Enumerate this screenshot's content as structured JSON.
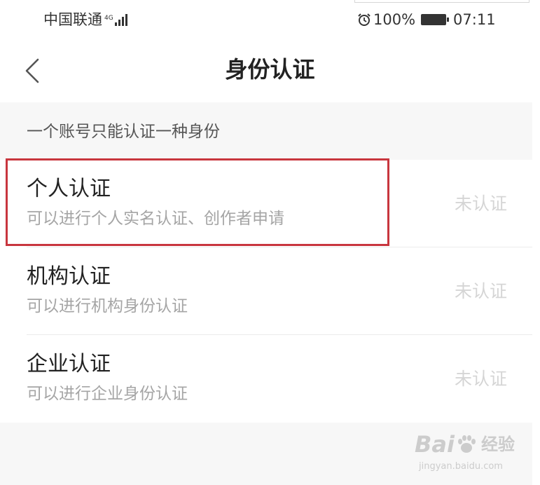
{
  "status_bar": {
    "carrier": "中国联通",
    "network": "4G",
    "battery_percent": "100%",
    "time": "07:11",
    "icons": [
      "signal-icon",
      "alarm-icon",
      "battery-icon"
    ]
  },
  "nav": {
    "title": "身份认证",
    "back_icon": "chevron-left-icon"
  },
  "hint": "一个账号只能认证一种身份",
  "items": [
    {
      "title": "个人认证",
      "desc": "可以进行个人实名认证、创作者申请",
      "status": "未认证"
    },
    {
      "title": "机构认证",
      "desc": "可以进行机构身份认证",
      "status": "未认证"
    },
    {
      "title": "企业认证",
      "desc": "可以进行企业身份认证",
      "status": "未认证"
    }
  ],
  "highlight_color": "#c8363e",
  "watermark": {
    "brand_left": "Bai",
    "brand_right": "经验",
    "url": "jingyan.baidu.com"
  }
}
